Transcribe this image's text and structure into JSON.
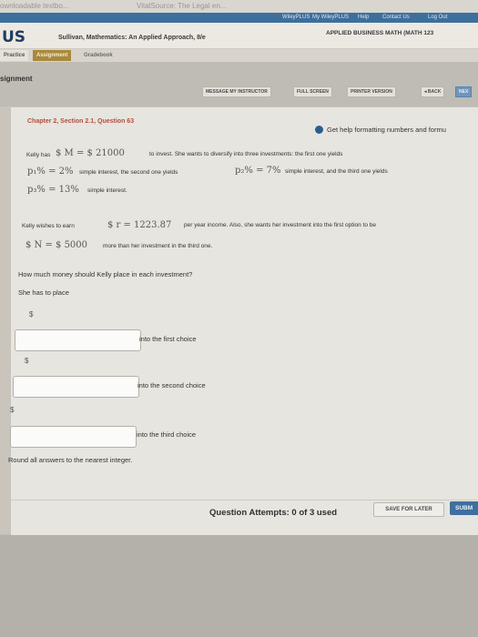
{
  "browser": {
    "tabs": [
      "ownloadable textbo...",
      "VitalSource: The Legal en..."
    ]
  },
  "toplinks": [
    "WileyPLUS",
    "My WileyPLUS",
    "Help",
    "Contact Us",
    "Log Out"
  ],
  "header": {
    "logo": "US",
    "course_title": "Sullivan, Mathematics: An Applied Approach, 8/e",
    "course_code": "APPLIED BUSINESS MATH (MATH 123"
  },
  "nav": {
    "practice": "Practice",
    "assignment": "Assignment",
    "gradebook": "Gradebook"
  },
  "page": {
    "title": "signment"
  },
  "toolbar": {
    "message": "MESSAGE MY INSTRUCTOR",
    "fullscreen": "FULL SCREEN",
    "printer": "PRINTER VERSION",
    "back": "◂ BACK",
    "next": "NEX"
  },
  "question": {
    "chapter": "Chapter 2, Section 2.1, Question 63",
    "help": "Get help formatting numbers and formu",
    "line1_a": "Kelly has",
    "line1_math": "$ M = $ 21000",
    "line1_b": "to invest. She wants to diversify into three investments: the first one yields",
    "line2_math1": "p₁% = 2%",
    "line2_a": "simple interest, the second one yields",
    "line2_math2": "p₂% = 7%",
    "line2_b": "simple interest, and the third one yields",
    "line3_math": "p₃% = 13%",
    "line3_a": "simple interest.",
    "line4_a": "Kelly wishes to earn",
    "line4_math": "$ r = 1223.87",
    "line4_b": "per year income. Also, she wants her investment into the first option to be",
    "line5_math": "$ N = $ 5000",
    "line5_a": "more than her investment in the third one.",
    "prompt": "How much money should Kelly place in each investment?",
    "prompt2": "She has to place",
    "currency": "$",
    "answers": [
      {
        "value": "",
        "label": "into the first choice"
      },
      {
        "value": "",
        "label": "into the second choice"
      },
      {
        "value": "",
        "label": "into the third choice"
      }
    ],
    "note": "Round all answers to the nearest integer."
  },
  "footer": {
    "attempts": "Question Attempts: 0 of 3 used",
    "save": "SAVE FOR LATER",
    "submit": "SUBM"
  },
  "colors": {
    "accent": "#3f6fa0",
    "chapter": "#b0503a",
    "nav_active": "#a9893a"
  }
}
